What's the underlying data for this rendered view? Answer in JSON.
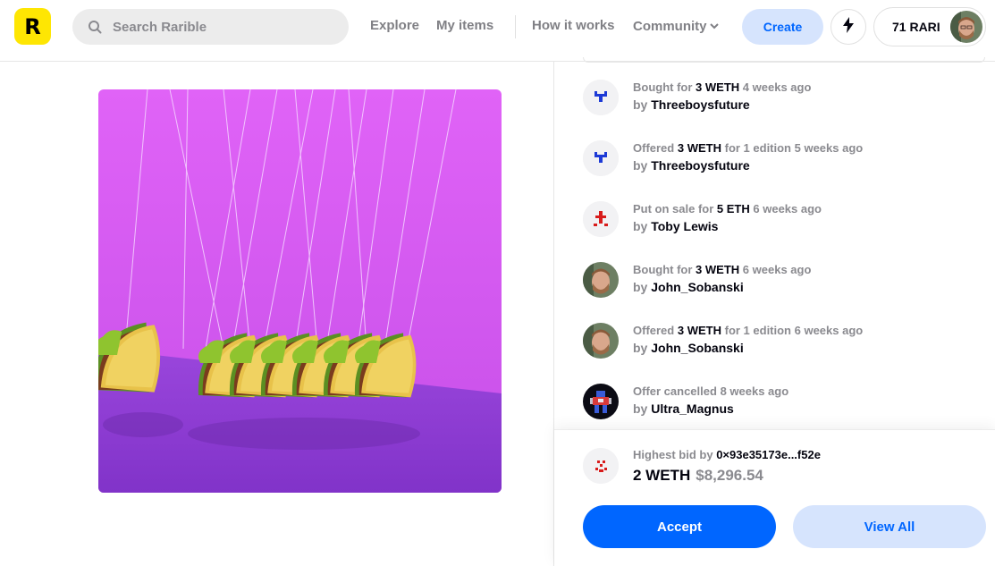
{
  "header": {
    "logo_letter": "R",
    "search_placeholder": "Search Rarible",
    "nav": [
      "Explore",
      "My items",
      "How it works",
      "Community"
    ],
    "create_label": "Create",
    "balance": "71 RARI"
  },
  "activity": [
    {
      "action": "Bought for",
      "amount": "3 WETH",
      "rest": "4 weeks ago",
      "by": "by",
      "user": "Threeboysfuture",
      "avatar": "blue-pixel-avatar"
    },
    {
      "action": "Offered",
      "amount": "3 WETH",
      "rest": "for 1 edition 5 weeks ago",
      "by": "by",
      "user": "Threeboysfuture",
      "avatar": "blue-pixel-avatar"
    },
    {
      "action": "Put on sale for",
      "amount": "5 ETH",
      "rest": "6 weeks ago",
      "by": "by",
      "user": "Toby Lewis",
      "avatar": "red-pixel-avatar"
    },
    {
      "action": "Bought for",
      "amount": "3 WETH",
      "rest": "6 weeks ago",
      "by": "by",
      "user": "John_Sobanski",
      "avatar": "photo-avatar"
    },
    {
      "action": "Offered",
      "amount": "3 WETH",
      "rest": "for 1 edition 6 weeks ago",
      "by": "by",
      "user": "John_Sobanski",
      "avatar": "photo-avatar"
    },
    {
      "action": "Offer cancelled",
      "amount": "",
      "rest": "8 weeks ago",
      "by": "by",
      "user": "Ultra_Magnus",
      "avatar": "robot-avatar"
    }
  ],
  "bid": {
    "label": "Highest bid by",
    "bidder": "0×93e35173e...f52e",
    "amount": "2 WETH",
    "usd": "$8,296.54",
    "accept_label": "Accept",
    "view_all_label": "View All"
  },
  "colors": {
    "accent": "#0066ff",
    "accent_light": "#d6e4fd",
    "logo_yellow": "#fee603",
    "art_top": "#d65ef5",
    "art_floor": "#8f3fd6"
  }
}
